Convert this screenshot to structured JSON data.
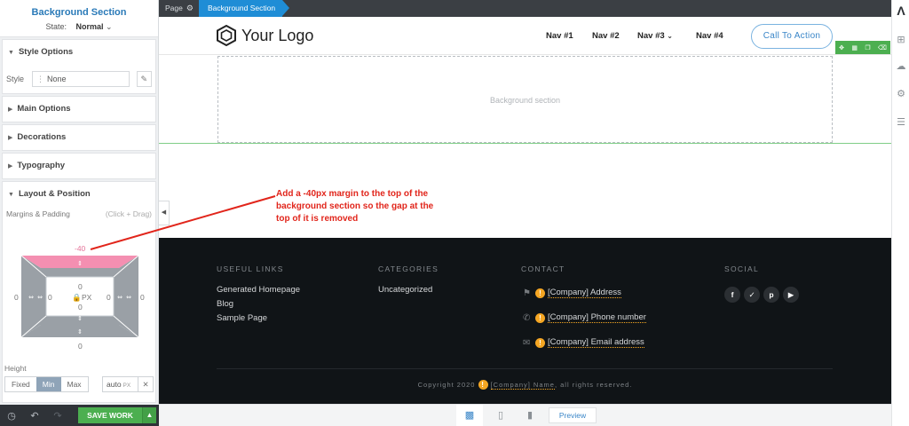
{
  "left_panel": {
    "title": "Background Section",
    "state_label": "State:",
    "state_value": "Normal",
    "sections": {
      "style_options": "Style Options",
      "main_options": "Main Options",
      "decorations": "Decorations",
      "typography": "Typography",
      "layout_position": "Layout & Position"
    },
    "style_label": "Style",
    "style_value": "None",
    "margins_label": "Margins & Padding",
    "margins_hint": "(Click + Drag)",
    "box_model": {
      "margin_top": "-40",
      "margin_left": "0",
      "margin_right": "0",
      "margin_bottom": "0",
      "padding_top": "0",
      "padding_left": "0",
      "padding_right": "0",
      "padding_bottom": "0",
      "unit": "PX"
    },
    "height_label": "Height",
    "height_options": [
      "Fixed",
      "Min",
      "Max"
    ],
    "height_selected": "Min",
    "height_value": "auto",
    "height_unit": "PX",
    "save_label": "SAVE WORK"
  },
  "breadcrumb": {
    "page": "Page",
    "active": "Background Section"
  },
  "site_header": {
    "logo_text": "Your Logo",
    "nav": [
      "Nav #1",
      "Nav #2",
      "Nav #3",
      "Nav #4"
    ],
    "cta_label": "Call To Action"
  },
  "canvas": {
    "bg_section_placeholder": "Background section"
  },
  "annotation": "Add a -40px margin to the top of the background section so the gap at the top of it is removed",
  "footer": {
    "useful_links_heading": "USEFUL LINKS",
    "useful_links": [
      "Generated Homepage",
      "Blog",
      "Sample Page"
    ],
    "categories_heading": "CATEGORIES",
    "categories": [
      "Uncategorized"
    ],
    "contact_heading": "CONTACT",
    "contact": [
      "[Company] Address",
      "[Company] Phone number",
      "[Company] Email address"
    ],
    "social_heading": "SOCIAL",
    "copyright_prefix": "Copyright 2020",
    "copyright_company": "[Company] Name",
    "copyright_suffix": ", all rights reserved."
  },
  "device_bar": {
    "preview_label": "Preview"
  },
  "colors": {
    "accent": "#1f8dd6",
    "save_green": "#4caf50",
    "annotation_red": "#e1251b",
    "footer_bg": "#101417",
    "margin_highlight": "#f48fb1"
  }
}
